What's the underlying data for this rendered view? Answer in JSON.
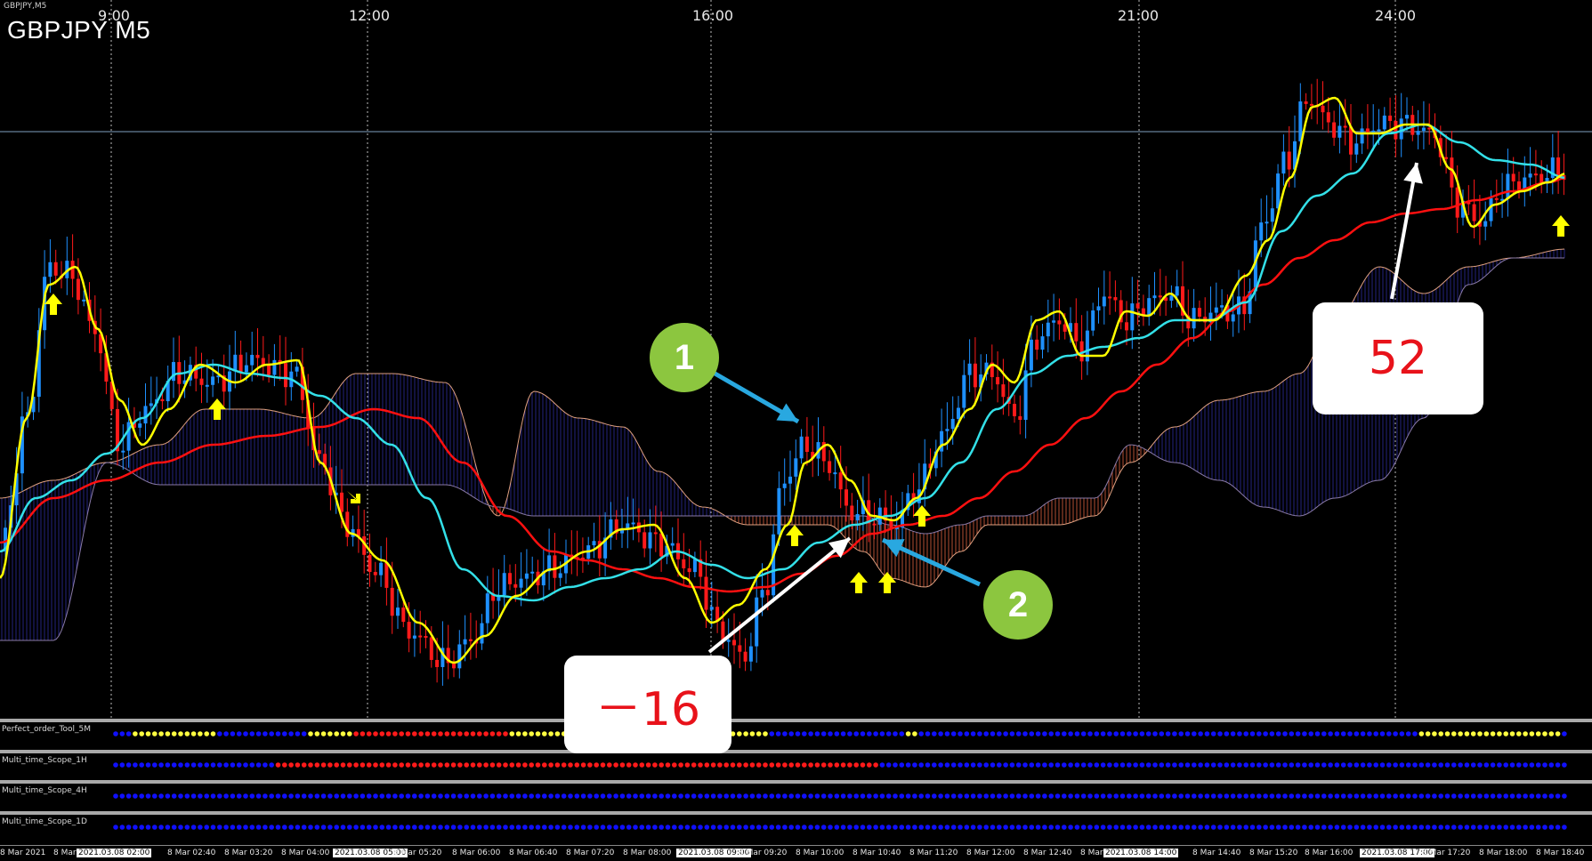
{
  "chart_header": {
    "symbol_small": "GBPJPY,M5",
    "symbol_big": "GBPJPY M5"
  },
  "top_time_labels": [
    "9:00",
    "12:00",
    "16:00",
    "21:00",
    "24:00"
  ],
  "bottom_time_labels": [
    {
      "text": "8 Mar 2021",
      "boxed": false
    },
    {
      "text": "8 Mar",
      "boxed": false
    },
    {
      "text": "2021.03.08 02:00",
      "boxed": true
    },
    {
      "text": "8 Mar 02:40",
      "boxed": false
    },
    {
      "text": "8 Mar 03:20",
      "boxed": false
    },
    {
      "text": "8 Mar 04:00",
      "boxed": false
    },
    {
      "text": "2021.03.08 05:00",
      "boxed": true
    },
    {
      "text": "8 Mar 05:20",
      "boxed": false
    },
    {
      "text": "8 Mar 06:00",
      "boxed": false
    },
    {
      "text": "8 Mar 06:40",
      "boxed": false
    },
    {
      "text": "8 Mar 07:20",
      "boxed": false
    },
    {
      "text": "8 Mar 08:00",
      "boxed": false
    },
    {
      "text": "2021.03.08 09:00",
      "boxed": true
    },
    {
      "text": "8 Mar 09:20",
      "boxed": false
    },
    {
      "text": "8 Mar 10:00",
      "boxed": false
    },
    {
      "text": "8 Mar 10:40",
      "boxed": false
    },
    {
      "text": "8 Mar 11:20",
      "boxed": false
    },
    {
      "text": "8 Mar 12:00",
      "boxed": false
    },
    {
      "text": "8 Mar 12:40",
      "boxed": false
    },
    {
      "text": "8 Mar",
      "boxed": false
    },
    {
      "text": "2021.03.08 14:00",
      "boxed": true
    },
    {
      "text": "8 Mar 14:40",
      "boxed": false
    },
    {
      "text": "8 Mar 15:20",
      "boxed": false
    },
    {
      "text": "8 Mar 16:00",
      "boxed": false
    },
    {
      "text": "2021.03.08 17:00",
      "boxed": true
    },
    {
      "text": "8 Mar 17:20",
      "boxed": false
    },
    {
      "text": "8 Mar 18:00",
      "boxed": false
    },
    {
      "text": "8 Mar 18:40",
      "boxed": false
    }
  ],
  "indicators": [
    {
      "name": "Perfect_order_Tool_5M"
    },
    {
      "name": "Multi_time_Scope_1H"
    },
    {
      "name": "Multi_time_Scope_4H"
    },
    {
      "name": "Multi_time_Scope_1D"
    }
  ],
  "annotations": {
    "circle_1": "1",
    "circle_2": "2",
    "callout_loss": "－16",
    "callout_gain": "52"
  },
  "colors": {
    "background": "#000000",
    "bull_candle": "#1e90ff",
    "bear_candle": "#ff1a1a",
    "fast_ma": "#ffff00",
    "mid_ma": "#33e0e8",
    "slow_ma": "#ff1010",
    "cloud_bull": "#2a2a8c",
    "cloud_bear": "#c85a3a",
    "signal_arrow": "#ffff00",
    "callout_text": "#e8121a",
    "circle_fill": "#8cc63f",
    "arrow_blue": "#29a8e0",
    "arrow_white": "#ffffff"
  }
}
